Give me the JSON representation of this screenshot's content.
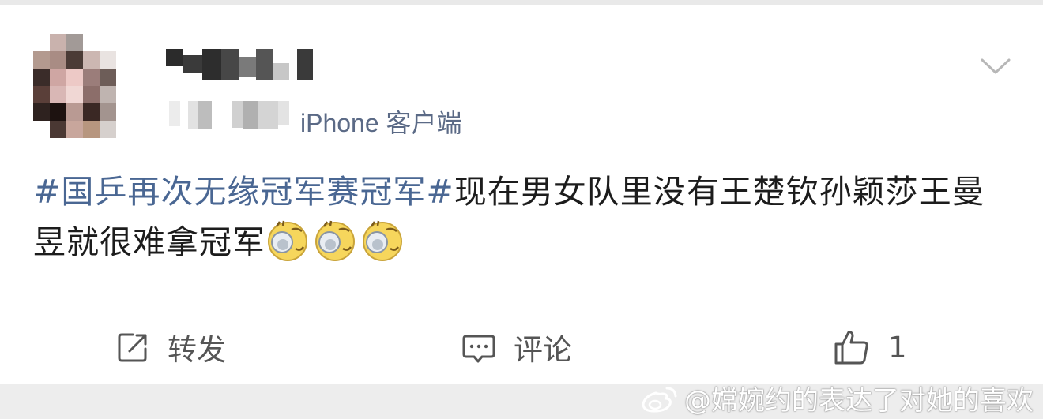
{
  "post": {
    "source": "iPhone 客户端",
    "topic": "#国乒再次无缘冠军赛冠军#",
    "body": "现在男女队里没有王楚钦孙颖莎王曼昱就很难拿冠军"
  },
  "actions": {
    "repost_label": "转发",
    "comment_label": "评论",
    "like_count": "1"
  },
  "watermark": {
    "text": "@嫦婉约的表达了对她的喜欢"
  },
  "colors": {
    "topic_link": "#4a6793",
    "source_text": "#5b6a86",
    "action_icon": "#555555"
  }
}
